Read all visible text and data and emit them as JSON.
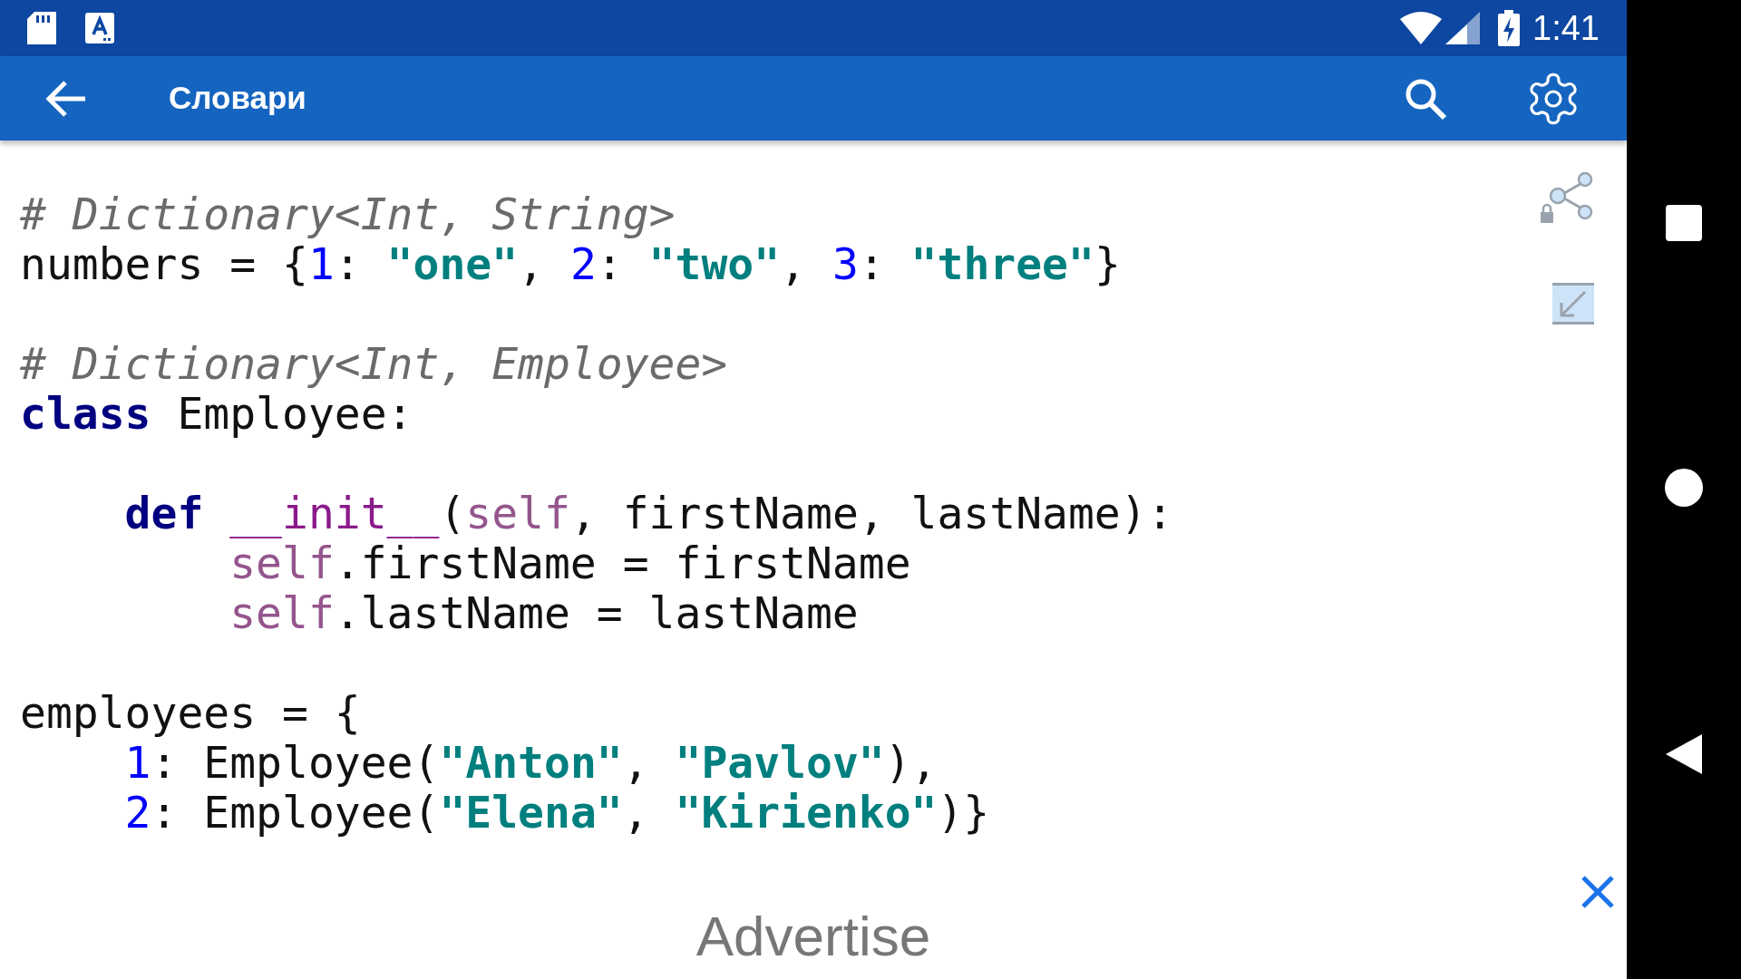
{
  "status_bar": {
    "time": "1:41"
  },
  "app_bar": {
    "title": "Словари"
  },
  "code_blocks": [
    [
      [
        {
          "kind": "comment",
          "text": "# Dictionary<Int, String>"
        }
      ],
      [
        {
          "kind": "plain",
          "text": "numbers = {"
        },
        {
          "kind": "number",
          "text": "1"
        },
        {
          "kind": "plain",
          "text": ": "
        },
        {
          "kind": "string",
          "text": "\"one\""
        },
        {
          "kind": "plain",
          "text": ", "
        },
        {
          "kind": "number",
          "text": "2"
        },
        {
          "kind": "plain",
          "text": ": "
        },
        {
          "kind": "string",
          "text": "\"two\""
        },
        {
          "kind": "plain",
          "text": ", "
        },
        {
          "kind": "number",
          "text": "3"
        },
        {
          "kind": "plain",
          "text": ": "
        },
        {
          "kind": "string",
          "text": "\"three\""
        },
        {
          "kind": "plain",
          "text": "}"
        }
      ]
    ],
    [
      [
        {
          "kind": "comment",
          "text": "# Dictionary<Int, Employee>"
        }
      ],
      [
        {
          "kind": "keyword",
          "text": "class"
        },
        {
          "kind": "plain",
          "text": " Employee:"
        }
      ]
    ],
    [
      [
        {
          "kind": "keyword",
          "text": "    def"
        },
        {
          "kind": "magic",
          "text": " __init__"
        },
        {
          "kind": "plain",
          "text": "("
        },
        {
          "kind": "self",
          "text": "self"
        },
        {
          "kind": "plain",
          "text": ", firstName, lastName):"
        }
      ],
      [
        {
          "kind": "self",
          "text": "        self"
        },
        {
          "kind": "plain",
          "text": ".firstName = firstName"
        }
      ],
      [
        {
          "kind": "self",
          "text": "        self"
        },
        {
          "kind": "plain",
          "text": ".lastName = lastName"
        }
      ]
    ],
    [
      [
        {
          "kind": "plain",
          "text": "employees = {"
        }
      ],
      [
        {
          "kind": "number",
          "text": "    1"
        },
        {
          "kind": "plain",
          "text": ": Employee("
        },
        {
          "kind": "string",
          "text": "\"Anton\""
        },
        {
          "kind": "plain",
          "text": ", "
        },
        {
          "kind": "string",
          "text": "\"Pavlov\""
        },
        {
          "kind": "plain",
          "text": "),"
        }
      ],
      [
        {
          "kind": "number",
          "text": "    2"
        },
        {
          "kind": "plain",
          "text": ": Employee("
        },
        {
          "kind": "string",
          "text": "\"Elena\""
        },
        {
          "kind": "plain",
          "text": ", "
        },
        {
          "kind": "string",
          "text": "\"Kirienko\""
        },
        {
          "kind": "plain",
          "text": ")}"
        }
      ]
    ]
  ],
  "ad": {
    "label": "Advertise"
  }
}
